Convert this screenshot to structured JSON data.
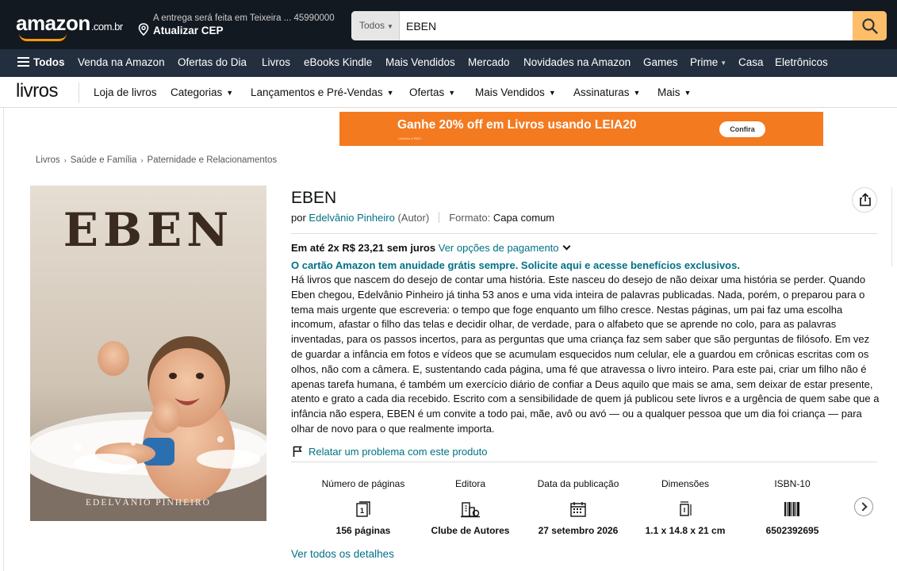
{
  "header": {
    "logo": "amazon",
    "logo_tld": ".com.br",
    "deliver_line1": "A entrega será feita em Teixeira ... 45990000",
    "deliver_line2": "Atualizar CEP",
    "search_category": "Todos",
    "search_value": "EBEN",
    "icons": {
      "location": "location-pin-icon",
      "search": "search-icon"
    }
  },
  "nav": {
    "all_label": "Todos",
    "items": [
      "Venda na Amazon",
      "Ofertas do Dia",
      "Livros",
      "eBooks Kindle",
      "Mais Vendidos",
      "Mercado",
      "Novidades na Amazon",
      "Games",
      "Prime",
      "Casa",
      "Eletrônicos"
    ]
  },
  "subnav": {
    "brand": "livros",
    "items": [
      "Loja de livros",
      "Categorias",
      "Lançamentos e Pré-Vendas",
      "Ofertas",
      "Mais Vendidos",
      "Assinaturas",
      "Mais"
    ]
  },
  "promo": {
    "text": "Ganhe 20% off em Livros usando LEIA20",
    "fine_print": "Limitado a R$10",
    "cta": "Confira",
    "color": "#f47a20"
  },
  "breadcrumb": [
    "Livros",
    "Saúde e Família",
    "Paternidade e Relacionamentos"
  ],
  "cover": {
    "title": "EBEN",
    "author": "EDELVÂNIO PINHEIRO"
  },
  "product": {
    "title": "EBEN",
    "by_prefix": "por",
    "author": "Edelvânio Pinheiro",
    "author_role": "(Autor)",
    "format_label": "Formato:",
    "format_value": "Capa comum",
    "installments_text": "Em até 2x R$ 23,21 sem juros",
    "payment_link": "Ver opções de pagamento",
    "card_promo": "O cartão Amazon tem anuidade grátis sempre. Solicite aqui e acesse benefícios exclusivos.",
    "description": "Há livros que nascem do desejo de contar uma história. Este nasceu do desejo de não deixar uma história se perder. Quando Eben chegou, Edelvânio Pinheiro já tinha 53 anos e uma vida inteira de palavras publicadas. Nada, porém, o preparou para o tema mais urgente que escreveria: o tempo que foge enquanto um filho cresce. Nestas páginas, um pai faz uma escolha incomum, afastar o filho das telas e decidir olhar, de verdade, para o alfabeto que se aprende no colo, para as palavras inventadas, para os passos incertos, para as perguntas que uma criança faz sem saber que são perguntas de filósofo. Em vez de guardar a infância em fotos e vídeos que se acumulam esquecidos num celular, ele a guardou em crônicas escritas com os olhos, não com a câmera. E, sustentando cada página, uma fé que atravessa o livro inteiro. Para este pai, criar um filho não é apenas tarefa humana, é também um exercício diário de confiar a Deus aquilo que mais se ama, sem deixar de estar presente, atento e grato a cada dia recebido. Escrito com a sensibilidade de quem já publicou sete livros e a urgência de quem sabe que a infância não espera, EBEN é um convite a todo pai, mãe, avô ou avó — ou a qualquer pessoa que um dia foi criança — para olhar de novo para o que realmente importa.",
    "report_link": "Relatar um problema com este produto",
    "see_all_details": "Ver todos os detalhes"
  },
  "attributes": [
    {
      "label": "Número de páginas",
      "value": "156 páginas",
      "icon": "pages-icon"
    },
    {
      "label": "Editora",
      "value": "Clube de Autores",
      "icon": "publisher-building-icon"
    },
    {
      "label": "Data da publicação",
      "value": "27 setembro 2026",
      "icon": "calendar-icon"
    },
    {
      "label": "Dimensões",
      "value": "1.1 x 14.8 x 21 cm",
      "icon": "dimensions-icon"
    },
    {
      "label": "ISBN-10",
      "value": "6502392695",
      "icon": "barcode-icon"
    }
  ],
  "colors": {
    "header_bg": "#131921",
    "nav_bg": "#232f3e",
    "search_button": "#febd69",
    "link": "#007185"
  }
}
